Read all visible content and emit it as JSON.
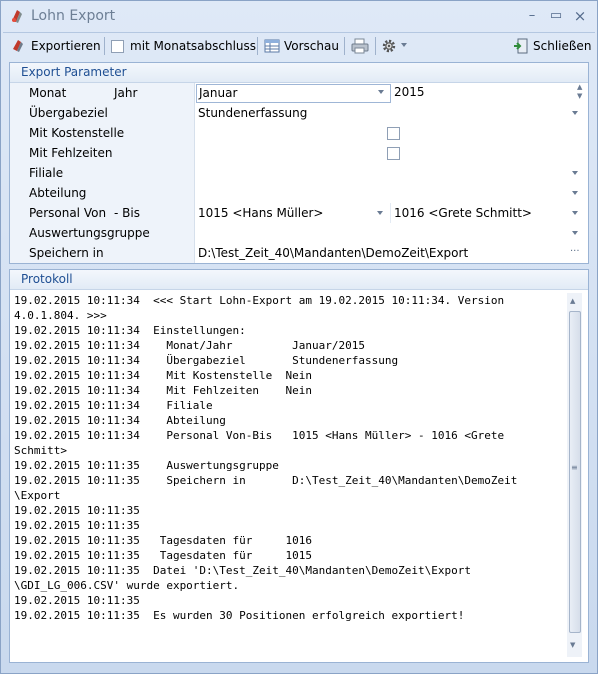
{
  "window": {
    "title": "Lohn Export",
    "minimize": "–",
    "maximize": "▭",
    "close": "×"
  },
  "toolbar": {
    "export_label": "Exportieren",
    "monthly_closing_label": "mit Monatsabschluss",
    "preview_label": "Vorschau",
    "close_label": "Schließen"
  },
  "params": {
    "title": "Export Parameter",
    "month_label": "Monat",
    "year_label": "Jahr",
    "month_value": "Januar",
    "year_value": "2015",
    "target_label": "Übergabeziel",
    "target_value": "Stundenerfassung",
    "cost_center_label": "Mit Kostenstelle",
    "cost_center_checked": false,
    "absence_label": "Mit Fehlzeiten",
    "absence_checked": false,
    "branch_label": "Filiale",
    "branch_value": "",
    "department_label": "Abteilung",
    "department_value": "",
    "staff_from_label": "Personal Von",
    "staff_to_label": "- Bis",
    "staff_from_value": "1015 <Hans Müller>",
    "staff_to_value": "1016 <Grete Schmitt>",
    "evaluation_group_label": "Auswertungsgruppe",
    "evaluation_group_value": "",
    "save_in_label": "Speichern in",
    "save_in_value": "D:\\Test_Zeit_40\\Mandanten\\DemoZeit\\Export",
    "browse": "···"
  },
  "log": {
    "title": "Protokoll",
    "lines": [
      "19.02.2015 10:11:34  <<< Start Lohn-Export am 19.02.2015 10:11:34. Version",
      "4.0.1.804. >>>",
      "19.02.2015 10:11:34  Einstellungen:",
      "19.02.2015 10:11:34    Monat/Jahr         Januar/2015",
      "19.02.2015 10:11:34    Übergabeziel       Stundenerfassung",
      "19.02.2015 10:11:34    Mit Kostenstelle  Nein",
      "19.02.2015 10:11:34    Mit Fehlzeiten    Nein",
      "19.02.2015 10:11:34    Filiale",
      "19.02.2015 10:11:34    Abteilung",
      "19.02.2015 10:11:34    Personal Von-Bis   1015 <Hans Müller> - 1016 <Grete",
      "Schmitt>",
      "19.02.2015 10:11:35    Auswertungsgruppe",
      "19.02.2015 10:11:35    Speichern in       D:\\Test_Zeit_40\\Mandanten\\DemoZeit",
      "\\Export",
      "19.02.2015 10:11:35",
      "19.02.2015 10:11:35",
      "19.02.2015 10:11:35   Tagesdaten für     1016",
      "19.02.2015 10:11:35   Tagesdaten für     1015",
      "19.02.2015 10:11:35  Datei 'D:\\Test_Zeit_40\\Mandanten\\DemoZeit\\Export",
      "\\GDI_LG_006.CSV' wurde exportiert.",
      "19.02.2015 10:11:35",
      "19.02.2015 10:11:35  Es wurden 30 Positionen erfolgreich exportiert!"
    ]
  }
}
